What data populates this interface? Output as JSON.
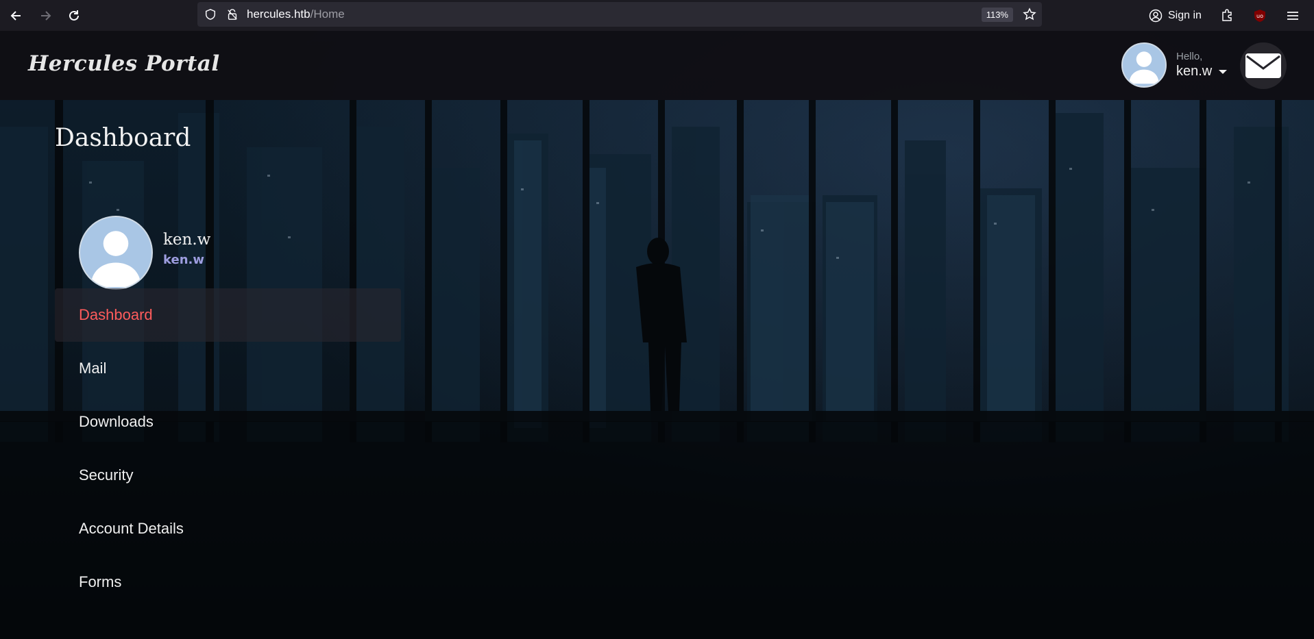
{
  "browser": {
    "url_host": "hercules.htb",
    "url_path": "/Home",
    "zoom": "113%",
    "signin_label": "Sign in"
  },
  "header": {
    "brand": "Hercules Portal",
    "greeting": "Hello,",
    "username": "ken.w"
  },
  "main": {
    "title": "Dashboard",
    "profile": {
      "name": "ken.w",
      "handle": "ken.w"
    },
    "menu": [
      {
        "label": "Dashboard",
        "active": true
      },
      {
        "label": "Mail"
      },
      {
        "label": "Downloads"
      },
      {
        "label": "Security"
      },
      {
        "label": "Account Details"
      },
      {
        "label": "Forms"
      }
    ]
  },
  "colors": {
    "active_menu": "#ff5c5c",
    "handle": "#9d9ddf",
    "avatar_bg": "#a9c6e5"
  }
}
